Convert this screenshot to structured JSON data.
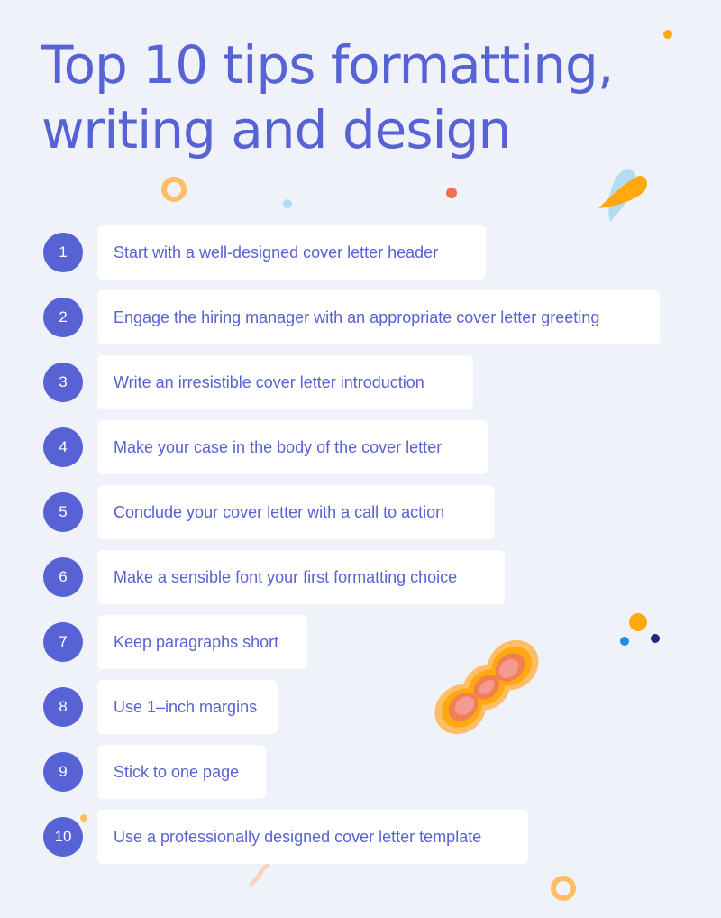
{
  "title": {
    "line1": "Top 10 tips formatting,",
    "line2": "writing and design"
  },
  "tips": [
    {
      "number": "1",
      "text": "Start with a well-designed cover letter header"
    },
    {
      "number": "2",
      "text": "Engage the hiring manager with an appropriate cover letter greeting"
    },
    {
      "number": "3",
      "text": "Write an irresistible cover letter introduction"
    },
    {
      "number": "4",
      "text": "Make your case in the body of the cover letter"
    },
    {
      "number": "5",
      "text": "Conclude your cover letter with a call to action"
    },
    {
      "number": "6",
      "text": "Make a sensible font your first formatting choice"
    },
    {
      "number": "7",
      "text": "Keep paragraphs short"
    },
    {
      "number": "8",
      "text": "Use 1–inch margins"
    },
    {
      "number": "9",
      "text": "Stick to one page"
    },
    {
      "number": "10",
      "text": "Use a professionally designed cover letter template"
    }
  ],
  "colors": {
    "accent": "#5762d5",
    "background": "#eff3f9",
    "card": "#ffffff",
    "deco_orange": "#ffa90f",
    "deco_light_orange": "#ffbd66",
    "deco_coral": "#f0704f",
    "deco_light_blue": "#b3dcf0",
    "deco_blue": "#1b8fe8",
    "deco_navy": "#1b2a7a"
  }
}
